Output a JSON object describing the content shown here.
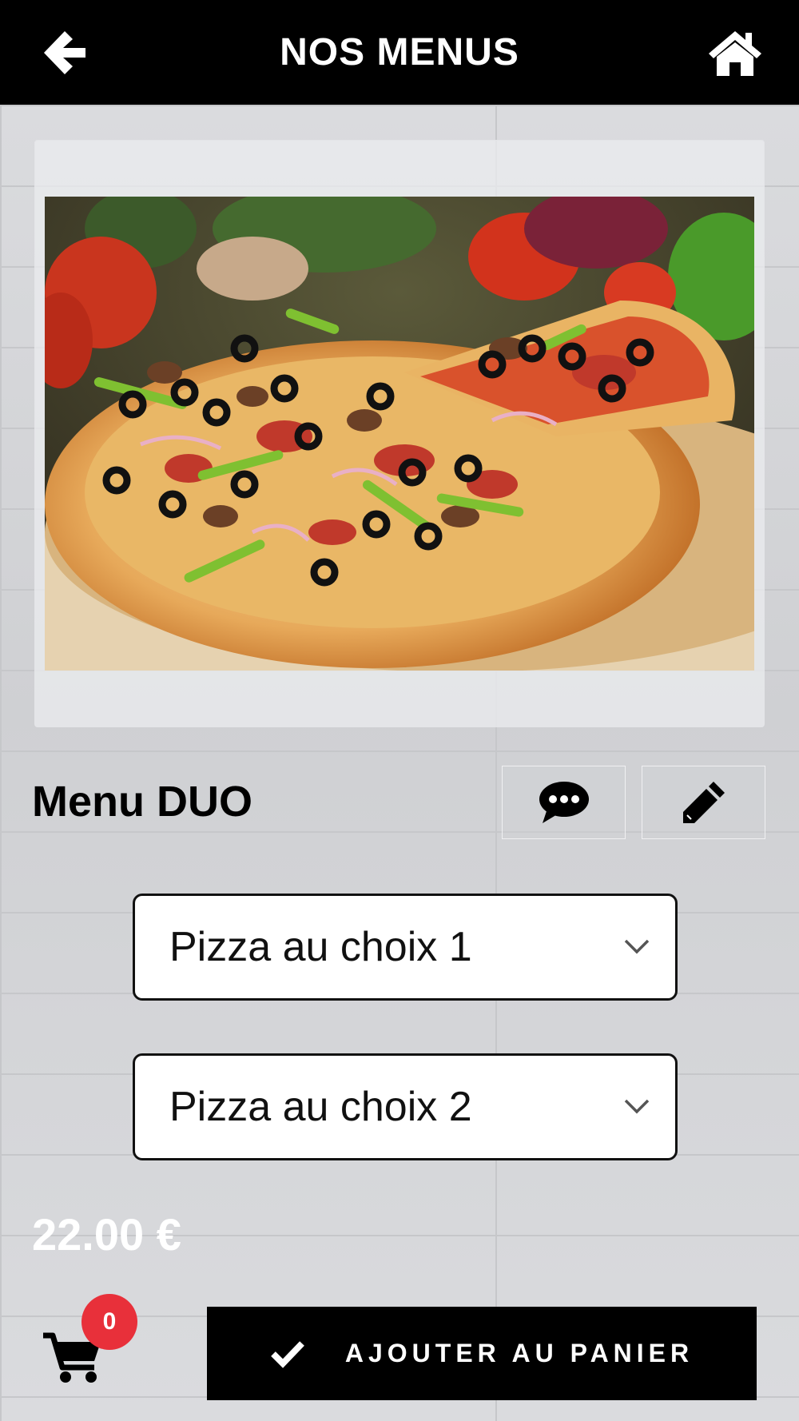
{
  "header": {
    "title": "NOS MENUS",
    "back_icon": "arrow-left-icon",
    "home_icon": "home-icon"
  },
  "product": {
    "image_icon": "pizza-photo",
    "title": "Menu DUO",
    "comment_icon": "comment-icon",
    "edit_icon": "pencil-icon",
    "selects": [
      {
        "value": "Pizza au choix 1"
      },
      {
        "value": "Pizza au choix 2"
      }
    ],
    "price": "22.00 €"
  },
  "cart": {
    "icon": "shopping-cart-icon",
    "count": "0"
  },
  "add_button": {
    "label": "AJOUTER AU PANIER",
    "icon": "check-icon"
  },
  "colors": {
    "header_bg": "#000000",
    "badge": "#e8303a",
    "button_bg": "#000000"
  }
}
